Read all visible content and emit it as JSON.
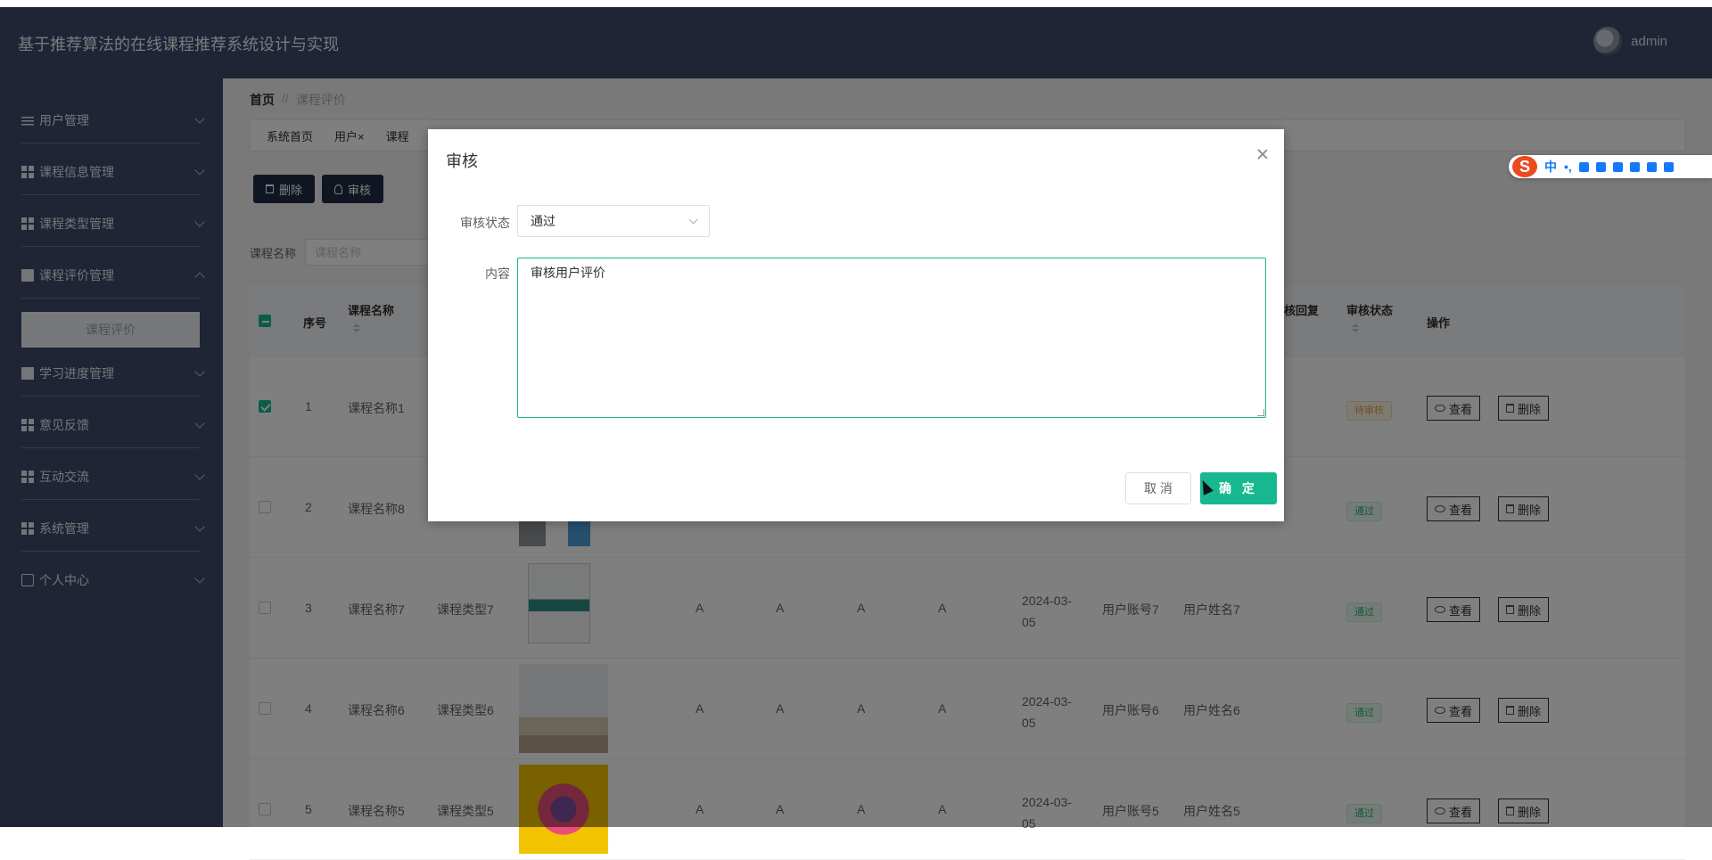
{
  "header": {
    "title": "基于推荐算法的在线课程推荐系统设计与实现",
    "user": "admin"
  },
  "sidebar": {
    "items": [
      {
        "label": "用户管理",
        "icon": "sliders-icon"
      },
      {
        "label": "课程信息管理",
        "icon": "grid-icon"
      },
      {
        "label": "课程类型管理",
        "icon": "grid-icon"
      },
      {
        "label": "课程评价管理",
        "icon": "document-icon",
        "expanded": true
      },
      {
        "label": "学习进度管理",
        "icon": "chart-icon"
      },
      {
        "label": "意见反馈",
        "icon": "grid-icon"
      },
      {
        "label": "互动交流",
        "icon": "grid-icon"
      },
      {
        "label": "系统管理",
        "icon": "grid-icon"
      },
      {
        "label": "个人中心",
        "icon": "card-icon"
      }
    ],
    "submenu_active": "课程评价"
  },
  "breadcrumb": {
    "home": "首页",
    "sep": "//",
    "current": "课程评价"
  },
  "tabs": [
    "系统首页",
    "用户×",
    "课程"
  ],
  "toolbar": {
    "delete": "删除",
    "audit": "审核"
  },
  "search": {
    "label": "课程名称",
    "placeholder": "课程名称"
  },
  "table": {
    "headers": {
      "index": "序号",
      "course_name": "课程名称",
      "reply": "核回复",
      "audit_status": "审核状态",
      "ops": "操作"
    },
    "rows": [
      {
        "idx": "1",
        "name": "课程名称1",
        "type": "",
        "a": [
          "",
          "",
          "",
          ""
        ],
        "date": "",
        "account": "",
        "username": "",
        "status": "待审核",
        "status_type": "wait",
        "checked": true
      },
      {
        "idx": "2",
        "name": "课程名称8",
        "type": "",
        "a": [
          "",
          "",
          "",
          ""
        ],
        "date": "",
        "account": "",
        "username": "",
        "status": "通过",
        "status_type": "pass",
        "checked": false
      },
      {
        "idx": "3",
        "name": "课程名称7",
        "type": "课程类型7",
        "a": [
          "A",
          "A",
          "A",
          "A"
        ],
        "date": "2024-03-05",
        "account": "用户账号7",
        "username": "用户姓名7",
        "status": "通过",
        "status_type": "pass",
        "checked": false
      },
      {
        "idx": "4",
        "name": "课程名称6",
        "type": "课程类型6",
        "a": [
          "A",
          "A",
          "A",
          "A"
        ],
        "date": "2024-03-05",
        "account": "用户账号6",
        "username": "用户姓名6",
        "status": "通过",
        "status_type": "pass",
        "checked": false
      },
      {
        "idx": "5",
        "name": "课程名称5",
        "type": "课程类型5",
        "a": [
          "A",
          "A",
          "A",
          "A"
        ],
        "date": "2024-03-05",
        "account": "用户账号5",
        "username": "用户姓名5",
        "status": "通过",
        "status_type": "pass",
        "checked": false
      }
    ],
    "view_label": "查看",
    "delete_label": "删除"
  },
  "dialog": {
    "title": "审核",
    "status_label": "审核状态",
    "status_value": "通过",
    "content_label": "内容",
    "content_value": "审核用户评价",
    "cancel": "取 消",
    "ok": "确 定"
  },
  "ime": {
    "logo": "S",
    "mode": "中",
    "punct": "•,"
  },
  "colors": {
    "header": "#3f4b6b",
    "accent": "#17b890",
    "toolbar_btn": "#1f2d45"
  }
}
